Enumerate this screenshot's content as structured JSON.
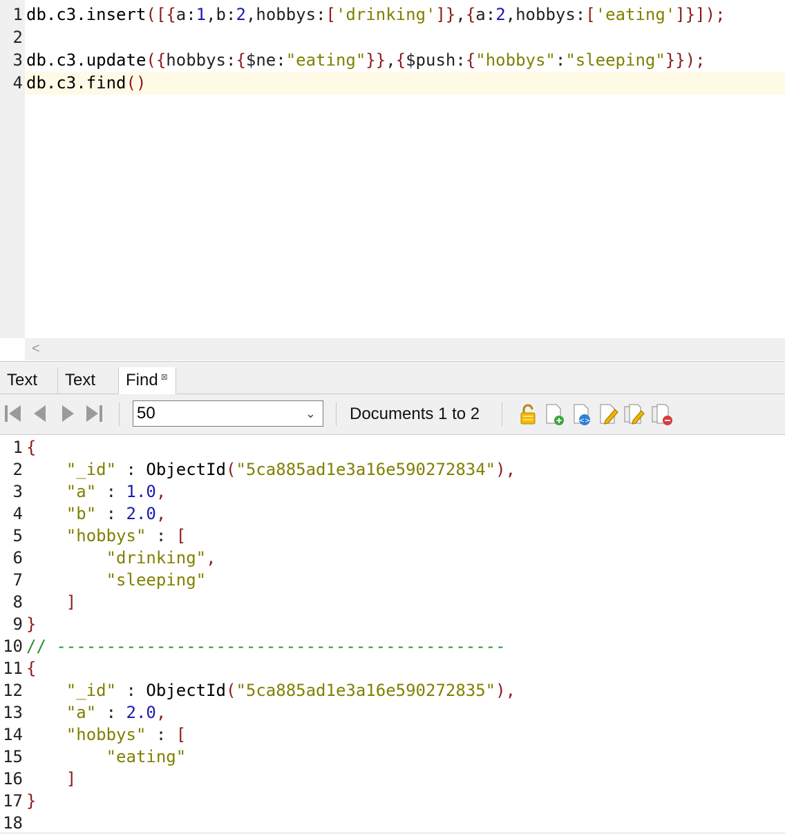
{
  "editor": {
    "lines": [
      {
        "n": "1",
        "tokens": [
          {
            "t": "db.c3.insert",
            "c": "fn"
          },
          {
            "t": "([{",
            "c": "br"
          },
          {
            "t": "a:",
            "c": "key"
          },
          {
            "t": "1",
            "c": "num"
          },
          {
            "t": ",b:",
            "c": "key"
          },
          {
            "t": "2",
            "c": "num"
          },
          {
            "t": ",hobbys:",
            "c": "key"
          },
          {
            "t": "[",
            "c": "br"
          },
          {
            "t": "'drinking'",
            "c": "str"
          },
          {
            "t": "]}",
            "c": "br"
          },
          {
            "t": ",",
            "c": "key"
          },
          {
            "t": "{",
            "c": "br"
          },
          {
            "t": "a:",
            "c": "key"
          },
          {
            "t": "2",
            "c": "num"
          },
          {
            "t": ",hobbys:",
            "c": "key"
          },
          {
            "t": "[",
            "c": "br"
          },
          {
            "t": "'eating'",
            "c": "str"
          },
          {
            "t": "]}]);",
            "c": "br"
          }
        ]
      },
      {
        "n": "2",
        "tokens": []
      },
      {
        "n": "3",
        "tokens": [
          {
            "t": "db.c3.update",
            "c": "fn"
          },
          {
            "t": "({",
            "c": "br"
          },
          {
            "t": "hobbys:",
            "c": "key"
          },
          {
            "t": "{",
            "c": "br"
          },
          {
            "t": "$ne:",
            "c": "key"
          },
          {
            "t": "\"eating\"",
            "c": "str"
          },
          {
            "t": "}}",
            "c": "br"
          },
          {
            "t": ",",
            "c": "key"
          },
          {
            "t": "{",
            "c": "br"
          },
          {
            "t": "$push:",
            "c": "key"
          },
          {
            "t": "{",
            "c": "br"
          },
          {
            "t": "\"hobbys\"",
            "c": "str"
          },
          {
            "t": ":",
            "c": "key"
          },
          {
            "t": "\"sleeping\"",
            "c": "str"
          },
          {
            "t": "}});",
            "c": "br"
          }
        ]
      },
      {
        "n": "4",
        "tokens": [
          {
            "t": "db.c3.find",
            "c": "fn"
          },
          {
            "t": "()",
            "c": "br"
          }
        ]
      }
    ],
    "scroll_left": "<"
  },
  "tabs": [
    {
      "label": "Text",
      "closable": false,
      "active": false
    },
    {
      "label": "Text",
      "closable": false,
      "active": false
    },
    {
      "label": "Find",
      "closable": true,
      "active": true
    }
  ],
  "tab_close_glyph": "⊠",
  "toolbar": {
    "page_size": "50",
    "page_size_options": [
      "50"
    ],
    "documents_label": "Documents 1 to 2",
    "nav_buttons": [
      "first-page",
      "previous-page",
      "next-page",
      "last-page"
    ],
    "tool_buttons": [
      "lock-icon",
      "add-document-icon",
      "view-json-icon",
      "edit-document-icon",
      "edit-multiple-icon",
      "delete-document-icon"
    ]
  },
  "output": {
    "lines": [
      {
        "n": "1",
        "tokens": [
          {
            "t": "{",
            "c": "br"
          }
        ]
      },
      {
        "n": "2",
        "tokens": [
          {
            "t": "    ",
            "c": "key"
          },
          {
            "t": "\"_id\"",
            "c": "str"
          },
          {
            "t": " : ",
            "c": "key"
          },
          {
            "t": "ObjectId",
            "c": "obj"
          },
          {
            "t": "(",
            "c": "br"
          },
          {
            "t": "\"5ca885ad1e3a16e590272834\"",
            "c": "str"
          },
          {
            "t": "),",
            "c": "br"
          }
        ]
      },
      {
        "n": "3",
        "tokens": [
          {
            "t": "    ",
            "c": "key"
          },
          {
            "t": "\"a\"",
            "c": "str"
          },
          {
            "t": " : ",
            "c": "key"
          },
          {
            "t": "1.0",
            "c": "num"
          },
          {
            "t": ",",
            "c": "br"
          }
        ]
      },
      {
        "n": "4",
        "tokens": [
          {
            "t": "    ",
            "c": "key"
          },
          {
            "t": "\"b\"",
            "c": "str"
          },
          {
            "t": " : ",
            "c": "key"
          },
          {
            "t": "2.0",
            "c": "num"
          },
          {
            "t": ",",
            "c": "br"
          }
        ]
      },
      {
        "n": "5",
        "tokens": [
          {
            "t": "    ",
            "c": "key"
          },
          {
            "t": "\"hobbys\"",
            "c": "str"
          },
          {
            "t": " : ",
            "c": "key"
          },
          {
            "t": "[",
            "c": "br"
          }
        ]
      },
      {
        "n": "6",
        "tokens": [
          {
            "t": "        ",
            "c": "key"
          },
          {
            "t": "\"drinking\"",
            "c": "str"
          },
          {
            "t": ",",
            "c": "br"
          }
        ]
      },
      {
        "n": "7",
        "tokens": [
          {
            "t": "        ",
            "c": "key"
          },
          {
            "t": "\"sleeping\"",
            "c": "str"
          }
        ]
      },
      {
        "n": "8",
        "tokens": [
          {
            "t": "    ",
            "c": "key"
          },
          {
            "t": "]",
            "c": "br"
          }
        ]
      },
      {
        "n": "9",
        "tokens": [
          {
            "t": "}",
            "c": "br"
          }
        ]
      },
      {
        "n": "10",
        "tokens": [
          {
            "t": "// ---------------------------------------------",
            "c": "com"
          }
        ]
      },
      {
        "n": "11",
        "tokens": [
          {
            "t": "{",
            "c": "br"
          }
        ]
      },
      {
        "n": "12",
        "tokens": [
          {
            "t": "    ",
            "c": "key"
          },
          {
            "t": "\"_id\"",
            "c": "str"
          },
          {
            "t": " : ",
            "c": "key"
          },
          {
            "t": "ObjectId",
            "c": "obj"
          },
          {
            "t": "(",
            "c": "br"
          },
          {
            "t": "\"5ca885ad1e3a16e590272835\"",
            "c": "str"
          },
          {
            "t": "),",
            "c": "br"
          }
        ]
      },
      {
        "n": "13",
        "tokens": [
          {
            "t": "    ",
            "c": "key"
          },
          {
            "t": "\"a\"",
            "c": "str"
          },
          {
            "t": " : ",
            "c": "key"
          },
          {
            "t": "2.0",
            "c": "num"
          },
          {
            "t": ",",
            "c": "br"
          }
        ]
      },
      {
        "n": "14",
        "tokens": [
          {
            "t": "    ",
            "c": "key"
          },
          {
            "t": "\"hobbys\"",
            "c": "str"
          },
          {
            "t": " : ",
            "c": "key"
          },
          {
            "t": "[",
            "c": "br"
          }
        ]
      },
      {
        "n": "15",
        "tokens": [
          {
            "t": "        ",
            "c": "key"
          },
          {
            "t": "\"eating\"",
            "c": "str"
          }
        ]
      },
      {
        "n": "16",
        "tokens": [
          {
            "t": "    ",
            "c": "key"
          },
          {
            "t": "]",
            "c": "br"
          }
        ]
      },
      {
        "n": "17",
        "tokens": [
          {
            "t": "}",
            "c": "br"
          }
        ]
      },
      {
        "n": "18",
        "tokens": []
      }
    ]
  },
  "colors": {
    "bracket": "#8b1a1a",
    "number": "#1a1ab0",
    "string": "#808000",
    "comment": "#2e8b2e",
    "current_line": "#fffae6"
  }
}
